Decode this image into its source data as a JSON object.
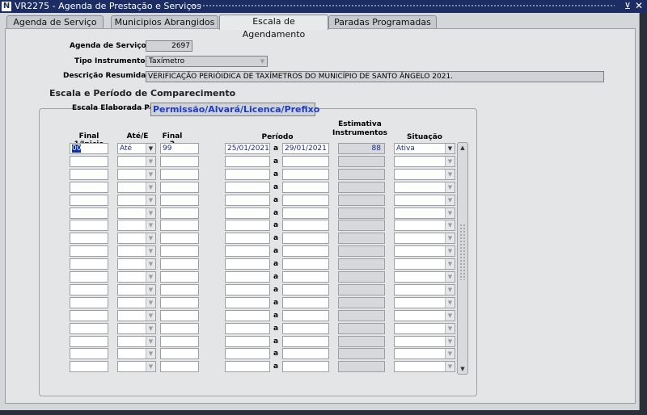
{
  "window": {
    "app_code": "VR2275",
    "separator": " - ",
    "title": "Agenda de Prestação e Serviços",
    "min_symbol": "⊻",
    "close_symbol": "✕",
    "icon": "app-n-icon"
  },
  "tabs": [
    {
      "label": "Agenda de Serviço"
    },
    {
      "label": "Municipios Abrangidos"
    },
    {
      "label": "Escala de Agendamento"
    },
    {
      "label": "Paradas Programadas"
    }
  ],
  "header": {
    "agenda_label": "Agenda de Serviço",
    "agenda_value": "2697",
    "tipo_label": "Tipo Instrumento",
    "tipo_value": "Taxímetro",
    "descricao_label": "Descrição Resumida",
    "descricao_value": "VERIFICAÇÃO PERIÓIDICA DE TAXÍMETROS DO MUNICÍPIO DE SANTO ÂNGELO 2021."
  },
  "escala": {
    "group_title": "Escala e Período de Comparecimento",
    "elaborada_label": "Escala Elaborada Por",
    "elaborada_value": "Permissão/Alvará/Licenca/Prefixo"
  },
  "table": {
    "headers": {
      "final1": "Final 1/Inicio",
      "ate": "Até/E",
      "final2": "Final 2",
      "periodo": "Período",
      "estimativa": "Estimativa Instrumentos",
      "situacao": "Situação"
    },
    "separator": "a",
    "first_row": {
      "final1": "00",
      "ate": "Até",
      "final2": "99",
      "periodo_inicio": "25/01/2021",
      "periodo_fim": "29/01/2021",
      "estimativa": "88",
      "situacao": "Ativa"
    }
  },
  "colors": {
    "titlebar": "#1c2d63",
    "value_text": "#1a2a8a",
    "escala_value": "#1a3ccc"
  }
}
